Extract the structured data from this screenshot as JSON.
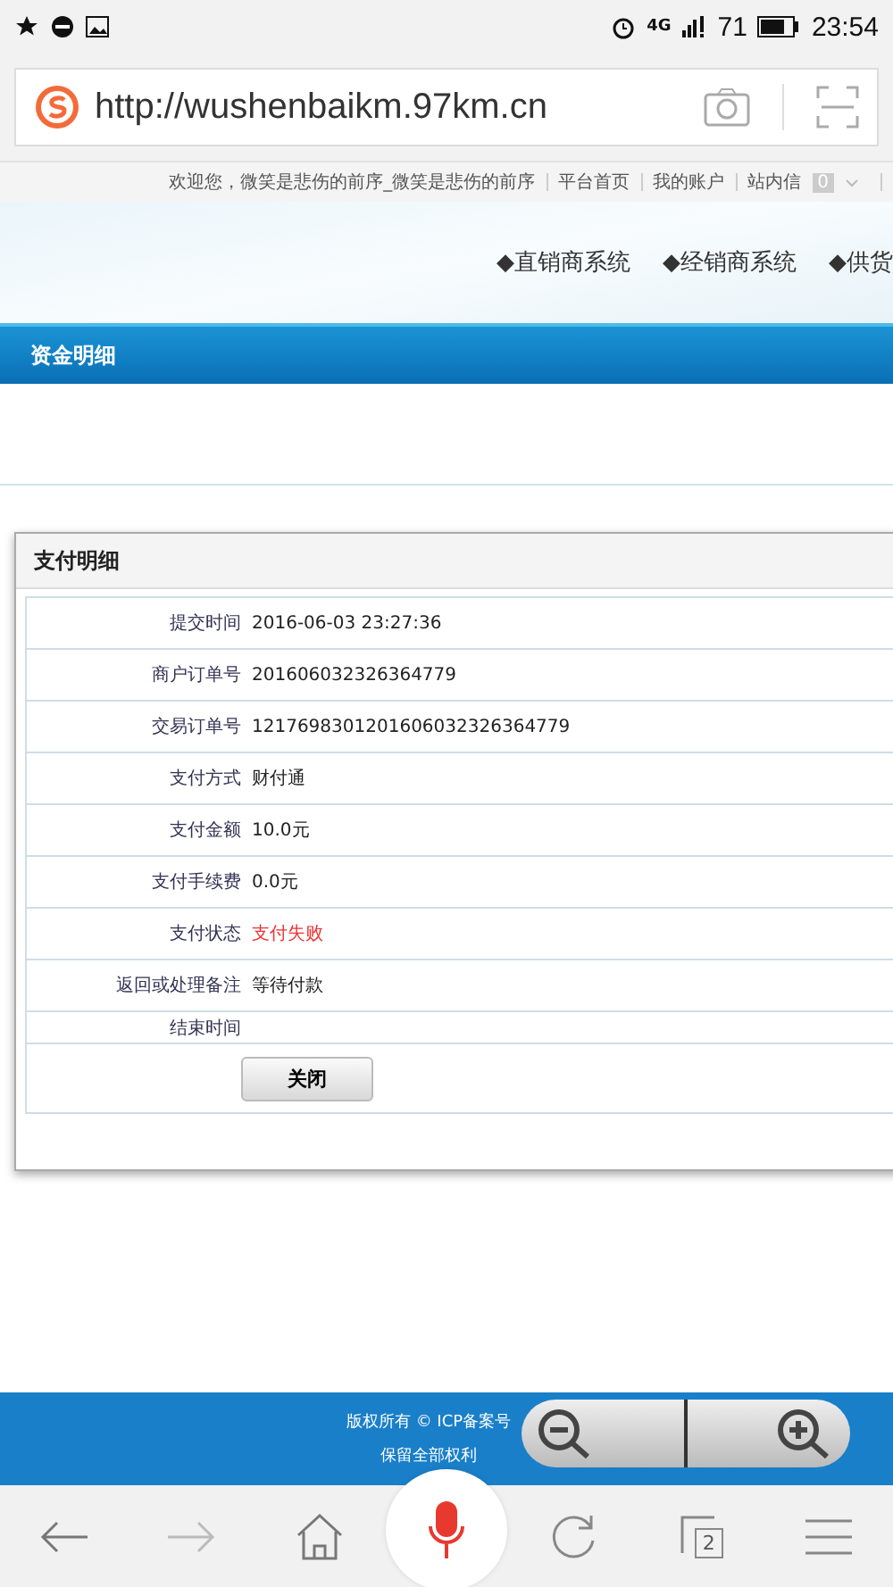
{
  "status_bar": {
    "network": "4G",
    "battery": "71",
    "time": "23:54"
  },
  "browser": {
    "url": "http://wushenbaikm.97km.cn"
  },
  "top_links": {
    "welcome": "欢迎您，微笑是悲伤的前序_微笑是悲伤的前序",
    "links": [
      "平台首页",
      "我的账户",
      "站内信"
    ],
    "message_count": "0"
  },
  "banner": {
    "systems": [
      "◆直销商系统",
      "◆经销商系统",
      "◆供货"
    ]
  },
  "page_title": "资金明细",
  "dialog": {
    "title": "支付明细",
    "rows": [
      {
        "label": "提交时间",
        "value": "2016-06-03 23:27:36",
        "kind": "text"
      },
      {
        "label": "商户订单号",
        "value": "201606032326364779",
        "kind": "text"
      },
      {
        "label": "交易订单号",
        "value": "1217698301201606032326364779",
        "kind": "text"
      },
      {
        "label": "支付方式",
        "value": "财付通",
        "kind": "text"
      },
      {
        "label": "支付金额",
        "value": "10.0元",
        "kind": "text"
      },
      {
        "label": "支付手续费",
        "value": "0.0元",
        "kind": "text"
      },
      {
        "label": "支付状态",
        "value": "支付失败",
        "kind": "error"
      },
      {
        "label": "返回或处理备注",
        "value": "等待付款",
        "kind": "text"
      },
      {
        "label": "结束时间",
        "kind": "short"
      }
    ],
    "close_button": "关闭"
  },
  "footer": {
    "lines": [
      "版权所有 © ICP备案号",
      "保留全部权利"
    ]
  },
  "bottom_nav": {
    "tab_count": "2"
  }
}
